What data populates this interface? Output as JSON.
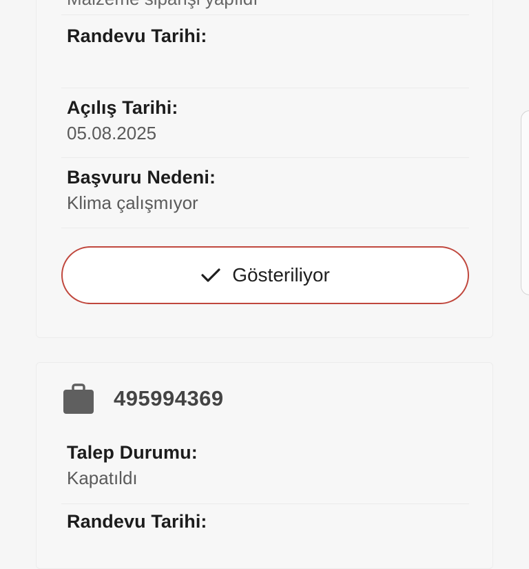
{
  "card1": {
    "cut_text": "Malzeme siparişi yapıldı",
    "appointment_label": "Randevu Tarihi:",
    "appointment_value": "",
    "opening_label": "Açılış Tarihi:",
    "opening_value": "05.08.2025",
    "reason_label": "Başvuru Nedeni:",
    "reason_value": "Klima çalışmıyor",
    "toggle_button_label": "Gösteriliyor"
  },
  "card2": {
    "ticket_number": "495994369",
    "status_label": "Talep Durumu:",
    "status_value": "Kapatıldı",
    "appointment_label": "Randevu Tarihi:"
  },
  "icons": {
    "check": "check-icon",
    "briefcase": "briefcase-icon"
  },
  "colors": {
    "button_border": "#c0473d",
    "icon_gray": "#5f5f5f"
  }
}
